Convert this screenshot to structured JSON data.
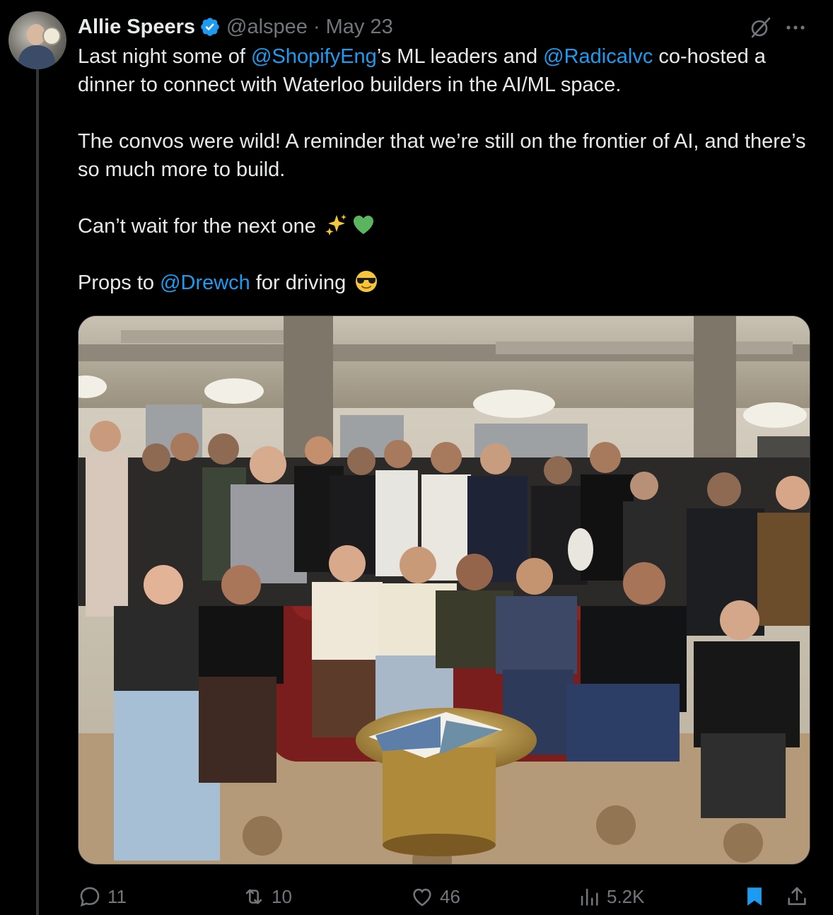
{
  "tweet": {
    "author_name": "Allie Speers",
    "handle": "@alspee",
    "separator": "·",
    "date": "May 23",
    "verified": true,
    "avatar_icon": "user-avatar",
    "paragraphs": [
      [
        {
          "text": "Last night some of ",
          "type": "text"
        },
        {
          "text": "@ShopifyEng",
          "type": "mention"
        },
        {
          "text": "’s ML leaders and ",
          "type": "text"
        },
        {
          "text": "@Radicalvc",
          "type": "mention"
        },
        {
          "text": " co-hosted a dinner to connect with Waterloo builders in the AI/ML space.",
          "type": "text"
        }
      ],
      [
        {
          "text": "The convos were wild! A reminder that we’re still on the frontier of AI, and there’s so much more to build.",
          "type": "text"
        }
      ],
      [
        {
          "text": "Can’t wait for the next one ",
          "type": "text"
        },
        {
          "text": "sparkles",
          "type": "emoji"
        },
        {
          "text": "green-heart",
          "type": "emoji"
        }
      ],
      [
        {
          "text": "Props to ",
          "type": "text"
        },
        {
          "text": "@Drewch",
          "type": "mention"
        },
        {
          "text": " for driving ",
          "type": "text"
        },
        {
          "text": "sunglasses-face",
          "type": "emoji"
        }
      ]
    ],
    "media_description_icon": "group-photo"
  },
  "actions": {
    "replies": "11",
    "retweets": "10",
    "likes": "46",
    "views": "5.2K"
  },
  "colors": {
    "background": "#000000",
    "text": "#e7e9ea",
    "muted": "#71767b",
    "accent": "#1d9bf0",
    "divider": "#333639"
  }
}
